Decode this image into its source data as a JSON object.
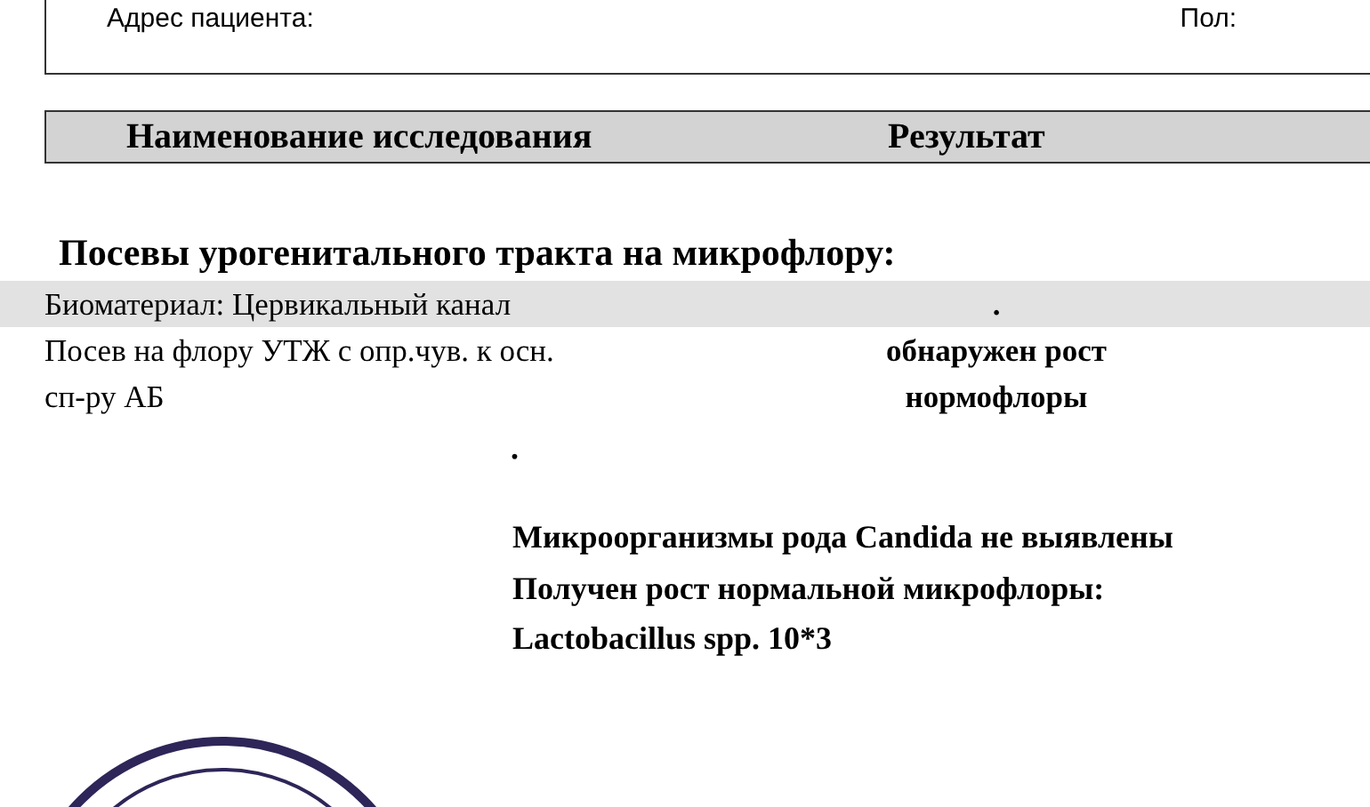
{
  "patient": {
    "address_label": "Адрес пациента:",
    "sex_label": "Пол:"
  },
  "table": {
    "columns": [
      "Наименование исследования",
      "Результат"
    ]
  },
  "section": {
    "title": "Посевы урогенитального тракта на микрофлору:",
    "rows": [
      {
        "name": "Биоматериал: Цервикальный канал",
        "result": ".",
        "shaded": true
      },
      {
        "name": "Посев на флору УТЖ с опр.чув. к осн.\nсп-ру АБ",
        "result": "обнаружен рост\nнормофлоры",
        "shaded": false
      }
    ],
    "separator": ".",
    "findings": [
      "Микроорганизмы рода Candida не выявлены",
      "Получен рост нормальной микрофлоры:",
      "Lactobacillus spp. 10*3"
    ]
  }
}
